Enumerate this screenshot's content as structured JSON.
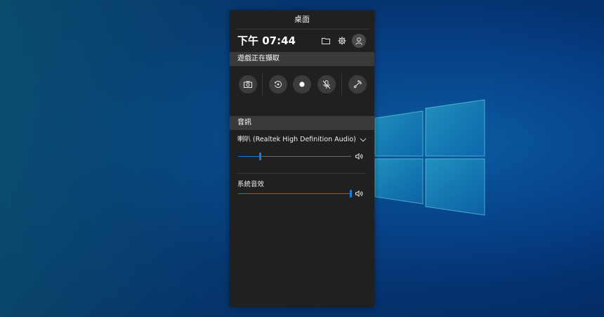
{
  "colors": {
    "accent": "#1e78d4",
    "panel_bg": "#202020",
    "section_bg": "#3a3a3a",
    "button_bg": "#3c3c3c"
  },
  "panel": {
    "title": "桌面",
    "clock": "下午 07:44",
    "top_icons": [
      "folder-icon",
      "gear-icon",
      "user-avatar-icon"
    ]
  },
  "capture": {
    "header": "遊戲正在擷取",
    "buttons": [
      "screenshot-icon",
      "record-last-icon",
      "record-icon",
      "mic-muted-icon",
      "broadcast-icon"
    ]
  },
  "audio": {
    "header": "音訊",
    "devices": [
      {
        "label": "喇叭 (Realtek High Definition Audio)",
        "volume": 0.2,
        "expandable": true
      },
      {
        "label": "系統音效",
        "volume": 1.0,
        "expandable": false
      }
    ]
  }
}
